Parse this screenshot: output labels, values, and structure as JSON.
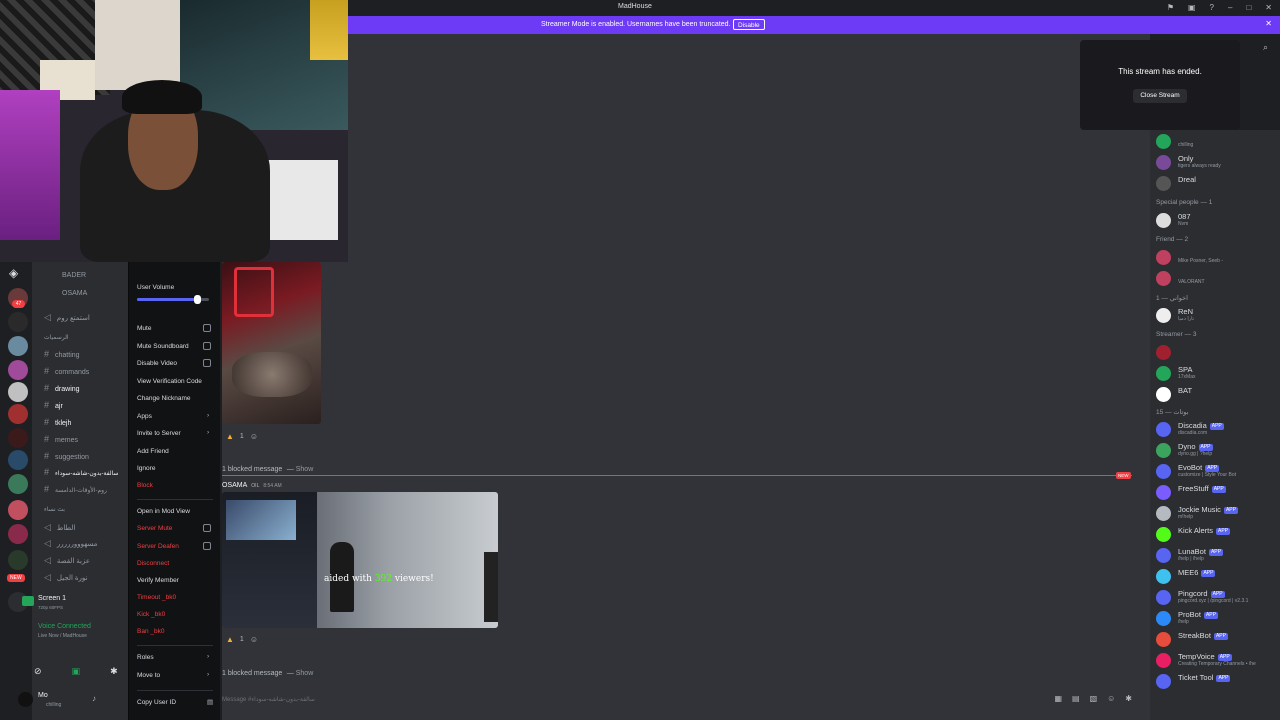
{
  "window": {
    "title": "MadHouse"
  },
  "banner": {
    "text": "Streamer Mode is enabled. Usernames have been truncated.",
    "disable_label": "Disable"
  },
  "ended_card": {
    "text": "This stream has ended.",
    "button": "Close Stream"
  },
  "channels": [
    {
      "name": "BADER",
      "kind": "user"
    },
    {
      "name": "OSAMA",
      "kind": "user"
    },
    {
      "name": "استمتع روم",
      "kind": "voice"
    },
    {
      "name": "الرسميات",
      "kind": "category"
    },
    {
      "name": "chatting",
      "kind": "text"
    },
    {
      "name": "commands",
      "kind": "text"
    },
    {
      "name": "drawing",
      "kind": "text"
    },
    {
      "name": "ajr",
      "kind": "text"
    },
    {
      "name": "tklejh",
      "kind": "text"
    },
    {
      "name": "memes",
      "kind": "text"
    },
    {
      "name": "suggestion",
      "kind": "text"
    },
    {
      "name": "سالفة-بدون-شاشه-سوداء",
      "kind": "text"
    },
    {
      "name": "روم-الأوقات-الدامسة",
      "kind": "text"
    },
    {
      "name": "بث نساء",
      "kind": "category"
    },
    {
      "name": "الطاط",
      "kind": "voice"
    },
    {
      "name": "مسهوووررررر",
      "kind": "voice"
    },
    {
      "name": "عزبة القصة",
      "kind": "voice"
    },
    {
      "name": "نورة الجيل",
      "kind": "voice"
    }
  ],
  "screen_share": {
    "title": "Screen 1",
    "sub": "720p 60FPS"
  },
  "voice": {
    "status": "Voice Connected",
    "sub": "Live Now / MadHouse"
  },
  "user_panel": {
    "name": "Mo",
    "status": "chilling"
  },
  "context_menu": {
    "user_volume": "User Volume",
    "volume_fraction": 0.83,
    "items": [
      {
        "label": "Mute",
        "type": "check"
      },
      {
        "label": "Mute Soundboard",
        "type": "check"
      },
      {
        "label": "Disable Video",
        "type": "check"
      },
      {
        "label": "View Verification Code",
        "type": "plain"
      },
      {
        "label": "Change Nickname",
        "type": "plain"
      },
      {
        "label": "Apps",
        "type": "sub"
      },
      {
        "label": "Invite to Server",
        "type": "sub"
      },
      {
        "label": "Add Friend",
        "type": "plain"
      },
      {
        "label": "Ignore",
        "type": "plain"
      },
      {
        "label": "Block",
        "type": "danger"
      },
      {
        "label": "Open in Mod View",
        "type": "plain"
      },
      {
        "label": "Server Mute",
        "type": "danger-check"
      },
      {
        "label": "Server Deafen",
        "type": "danger-check"
      },
      {
        "label": "Disconnect",
        "type": "danger"
      },
      {
        "label": "Verify Member",
        "type": "plain"
      },
      {
        "label": "Timeout _bk0",
        "type": "danger"
      },
      {
        "label": "Kick _bk0",
        "type": "danger"
      },
      {
        "label": "Ban _bk0",
        "type": "danger"
      },
      {
        "label": "Roles",
        "type": "sub"
      },
      {
        "label": "Move to",
        "type": "sub"
      },
      {
        "label": "Copy User ID",
        "type": "id"
      }
    ]
  },
  "messages": {
    "reaction_count_1": "1",
    "blocked_1": "1 blocked message",
    "show_label": "Show",
    "new_badge": "NEW",
    "author": "OSAMA",
    "author_tag": "OIL",
    "time": "8:54 AM",
    "overlay_text_left": "aided with",
    "overlay_num": "392",
    "overlay_text_right": "viewers!",
    "reaction_count_2": "1",
    "blocked_2": "1 blocked message",
    "input_placeholder": "Message #سالفة-بدون-شاشه-سوداء"
  },
  "members": {
    "top": [
      {
        "name": "",
        "status": "chilling"
      },
      {
        "name": "Only",
        "status": "tigers always ready"
      },
      {
        "name": "Dreal",
        "status": ""
      }
    ],
    "cat_special": "Special people — 1",
    "special": [
      {
        "name": "087",
        "status": "Nvm"
      }
    ],
    "cat_friend": "Friend — 2",
    "friend": [
      {
        "name": "",
        "status": "Mike Posner, Seeb -"
      },
      {
        "name": "",
        "status": "VALORANT"
      }
    ],
    "cat_ar": "اخواني — 1",
    "ar": [
      {
        "name": "ReN",
        "status": "تارا دميا"
      }
    ],
    "cat_streamer": "Streamer — 3",
    "streamer": [
      {
        "name": "",
        "status": ""
      },
      {
        "name": "SPA",
        "status": "17xMax"
      },
      {
        "name": "BAT",
        "status": ""
      }
    ],
    "cat_bots": "بوتات — 15",
    "bots": [
      {
        "name": "Discadia",
        "status": "discadia.com",
        "color": "#5865f2"
      },
      {
        "name": "Dyno",
        "status": "dyno.gg | ?help",
        "color": "#3ba55d"
      },
      {
        "name": "EvoBot",
        "status": "customize | Style Your Bot",
        "color": "#5865f2"
      },
      {
        "name": "FreeStuff",
        "status": "",
        "color": "#7a5cff"
      },
      {
        "name": "Jockie Music",
        "status": "m!help",
        "color": "#b5bac1"
      },
      {
        "name": "Kick Alerts",
        "status": "",
        "color": "#53fc18"
      },
      {
        "name": "LunaBot",
        "status": "/help | /help",
        "color": "#5865f2"
      },
      {
        "name": "MEE6",
        "status": "",
        "color": "#3fc1f0"
      },
      {
        "name": "Pingcord",
        "status": "pingcord.xyz | /pingcord | v2.3.1",
        "color": "#5865f2"
      },
      {
        "name": "ProBot",
        "status": "/help",
        "color": "#2b8af7"
      },
      {
        "name": "StreakBot",
        "status": "",
        "color": "#e74c3c"
      },
      {
        "name": "TempVoice",
        "status": "Creating Temporary Channels • /he",
        "color": "#e91e63"
      },
      {
        "name": "Ticket Tool",
        "status": "",
        "color": "#5865f2"
      }
    ],
    "app_label": "APP"
  }
}
